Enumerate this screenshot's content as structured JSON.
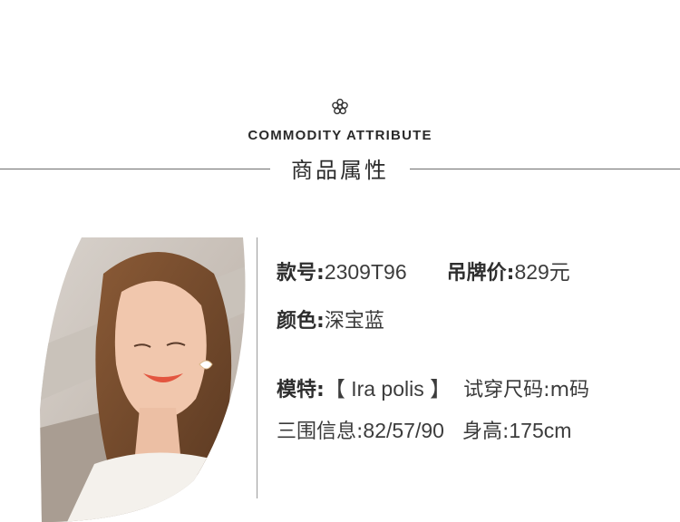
{
  "header": {
    "flower_icon": "flower-icon",
    "en_title": "COMMODITY ATTRIBUTE",
    "cn_title": "商品属性"
  },
  "attributes": {
    "style_no_label": "款号:",
    "style_no_value": "2309T96",
    "price_label": "吊牌价:",
    "price_value": "829元",
    "color_label": "颜色:",
    "color_value": "深宝蓝",
    "model_label": "模特:",
    "model_value": "【 Ira polis 】",
    "size_label": "试穿尺码:",
    "size_value": "m码",
    "measure_label": "三围信息:",
    "measure_value": "82/57/90",
    "height_label": "身高:",
    "height_value": "175cm"
  },
  "colors": {
    "rule": "#6e6e6e",
    "text": "#333333"
  }
}
